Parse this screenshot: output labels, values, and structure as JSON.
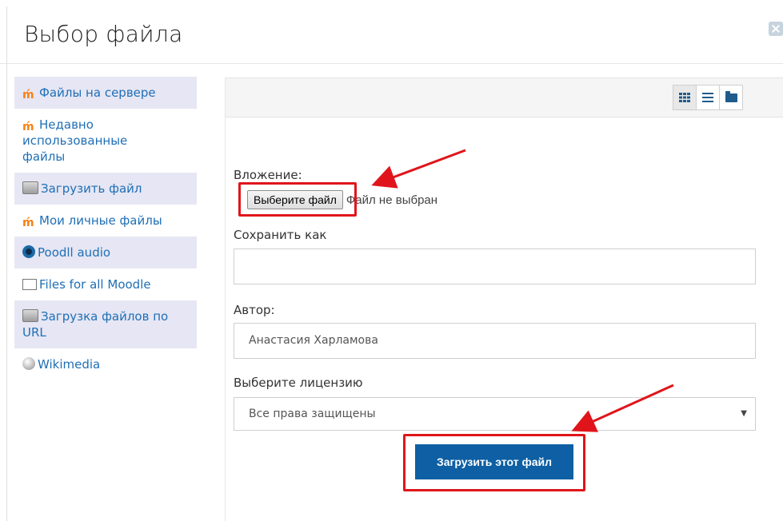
{
  "dialog": {
    "title": "Выбор файла"
  },
  "sidebar": {
    "items": [
      {
        "label": "Файлы на сервере",
        "icon": "moodle-icon"
      },
      {
        "label": "Недавно использованные файлы",
        "icon": "moodle-icon"
      },
      {
        "label": "Загрузить файл",
        "icon": "upload-icon"
      },
      {
        "label": "Мои личные файлы",
        "icon": "moodle-icon"
      },
      {
        "label": "Poodll audio",
        "icon": "poodll-icon"
      },
      {
        "label": "Files for all Moodle",
        "icon": "filesystem-icon"
      },
      {
        "label": "Загрузка файлов по URL",
        "icon": "upload-icon"
      },
      {
        "label": "Wikimedia",
        "icon": "wikimedia-icon"
      }
    ]
  },
  "toolbar": {
    "views": [
      "grid-view-icon",
      "list-view-icon",
      "folder-view-icon"
    ]
  },
  "form": {
    "attachment_label": "Вложение:",
    "choose_file_button": "Выберите файл",
    "no_file_text": "Файл не выбран",
    "save_as_label": "Сохранить как",
    "save_as_value": "",
    "author_label": "Автор:",
    "author_value": "Анастасия Харламова",
    "license_label": "Выберите лицензию",
    "license_value": "Все права защищены",
    "upload_button": "Загрузить этот файл"
  },
  "colors": {
    "annotation": "#e0151b",
    "link": "#1f6fb6",
    "primary_button": "#0e5fa3"
  }
}
